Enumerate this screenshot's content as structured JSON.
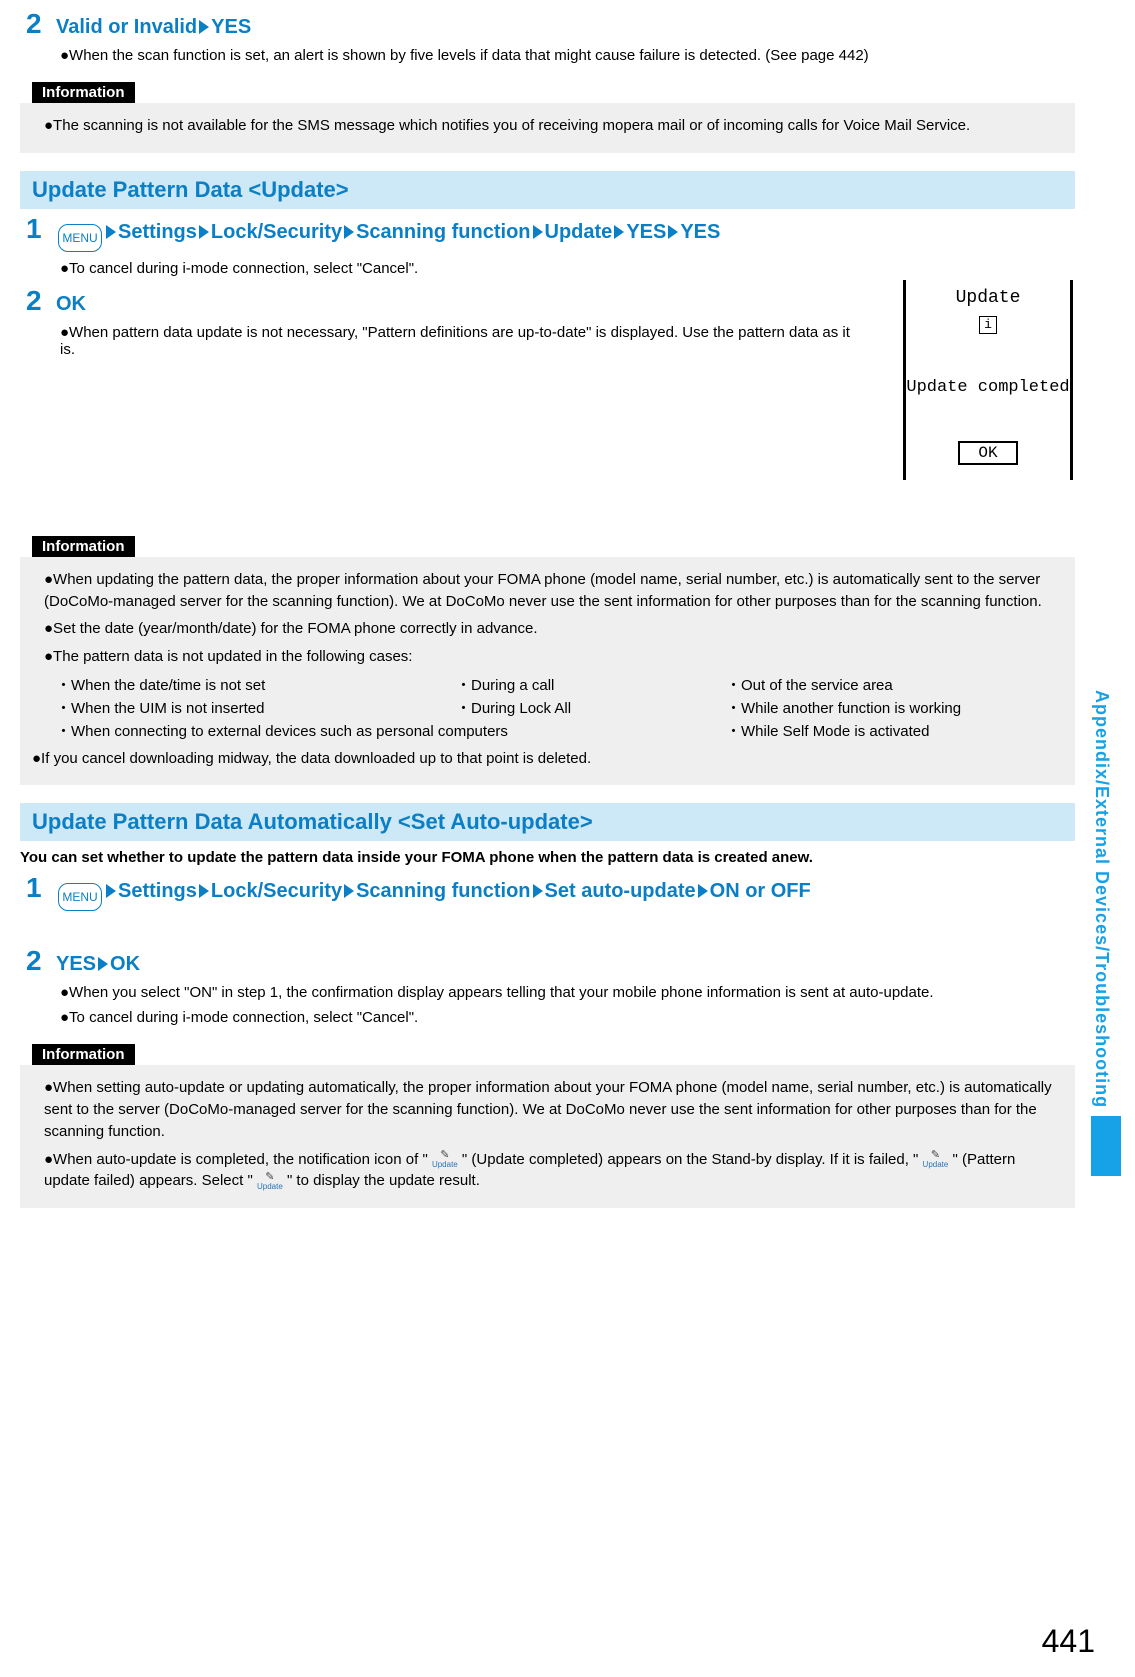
{
  "step2a": {
    "title_parts": [
      "Valid or Invalid",
      "YES"
    ],
    "bullet": "●When the scan function is set, an alert is shown by five levels if data that might cause failure is detected. (See page 442)"
  },
  "info1": {
    "label": "Information",
    "p1": "●The scanning is not available for the SMS message which notifies you of receiving mopera mail or of incoming calls for Voice Mail Service."
  },
  "section1": {
    "title": "Update Pattern Data <Update>"
  },
  "step1b": {
    "menu_label": "MENU",
    "parts": [
      "Settings",
      "Lock/Security",
      "Scanning function",
      "Update",
      "YES",
      "YES"
    ],
    "bullet": "●To cancel during i-mode connection, select \"Cancel\"."
  },
  "step2b": {
    "title": "OK",
    "bullet": "●When pattern data update is not necessary, \"Pattern definitions are up-to-date\" is displayed. Use the pattern data as it is."
  },
  "phone": {
    "title": "Update",
    "info": "i",
    "msg": "Update completed",
    "ok": "OK"
  },
  "info2": {
    "label": "Information",
    "p1": "●When updating the pattern data, the proper information about your FOMA phone (model name, serial number, etc.) is automatically sent to the server (DoCoMo-managed server for the scanning function). We at DoCoMo never use the sent information for other purposes than for the scanning function.",
    "p2": "●Set the date (year/month/date) for the FOMA phone correctly in advance.",
    "p3": "●The pattern data is not updated in the following cases:",
    "c1a": "・When the date/time is not set",
    "c1b": "・During a call",
    "c1c": "・Out of the service area",
    "c2a": "・When the UIM is not inserted",
    "c2b": "・During Lock All",
    "c2c": "・While another function is working",
    "c3a": "・When connecting to external devices such as personal computers",
    "c3c": "・While Self Mode is activated",
    "p4": "●If you cancel downloading midway, the data downloaded up to that point is deleted."
  },
  "section2": {
    "title": "Update Pattern Data Automatically <Set Auto-update>",
    "sub": "You can set whether to update the pattern data inside your FOMA phone when the pattern data is created anew."
  },
  "step1c": {
    "menu_label": "MENU",
    "parts": [
      "Settings",
      "Lock/Security",
      "Scanning function",
      "Set auto-update",
      "ON or OFF"
    ]
  },
  "step2c": {
    "parts": [
      "YES",
      "OK"
    ],
    "b1": "●When you select \"ON\" in step 1, the confirmation display appears telling that your mobile phone information is sent at auto-update.",
    "b2": "●To cancel during i-mode connection, select \"Cancel\"."
  },
  "info3": {
    "label": "Information",
    "p1": "●When setting auto-update or updating automatically, the proper information about your FOMA phone (model name, serial number, etc.) is automatically sent to the server (DoCoMo-managed server for the scanning function). We at DoCoMo never use the sent information for other purposes than for the scanning function.",
    "p2a": "●When auto-update is completed, the notification icon of \"",
    "p2b": "\" (Update completed) appears on the Stand-by display. If it is failed, \"",
    "p2c": "\" (Pattern update failed) appears. Select \"",
    "p2d": "\" to display the update result."
  },
  "side_label": "Appendix/External Devices/Troubleshooting",
  "page_number": "441",
  "icon_update_text": "Update"
}
